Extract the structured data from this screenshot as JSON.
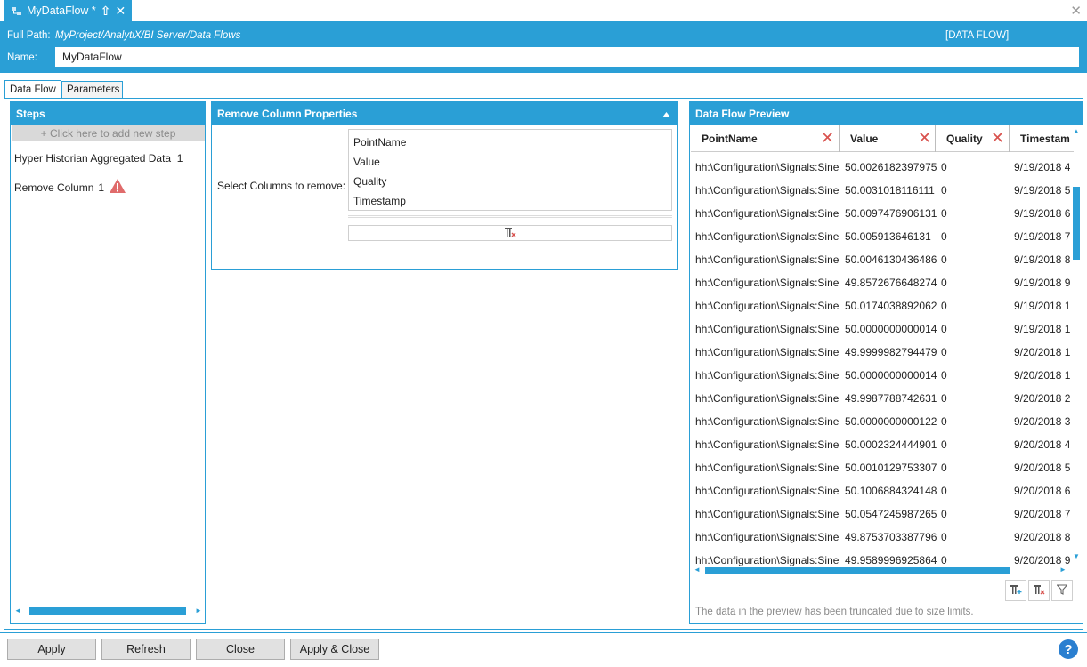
{
  "tab": {
    "title": "MyDataFlow *",
    "close_glyph": "✕",
    "pin_glyph": "⇧"
  },
  "window": {
    "close_glyph": "✕"
  },
  "header": {
    "full_path_label": "Full Path:",
    "full_path_value": "MyProject/AnalytiX/BI Server/Data Flows",
    "type_badge": "[DATA FLOW]",
    "name_label": "Name:",
    "name_value": "MyDataFlow"
  },
  "subtabs": {
    "data_flow": "Data Flow",
    "parameters": "Parameters"
  },
  "steps": {
    "title": "Steps",
    "add_step": "+ Click here to add new step",
    "items": [
      {
        "label": "Hyper Historian Aggregated Data",
        "count": "1"
      },
      {
        "label": "Remove Column",
        "count": "1"
      }
    ]
  },
  "props": {
    "title": "Remove Column Properties",
    "select_label": "Select Columns to remove:",
    "columns": [
      "PointName",
      "Value",
      "Quality",
      "Timestamp"
    ]
  },
  "preview": {
    "title": "Data Flow Preview",
    "headers": [
      "PointName",
      "Value",
      "Quality",
      "Timestam"
    ],
    "rows": [
      [
        "hh:\\Configuration\\Signals:Sine",
        "50.0026182397975",
        "0",
        "9/19/2018 4"
      ],
      [
        "hh:\\Configuration\\Signals:Sine",
        "50.0031018116111",
        "0",
        "9/19/2018 5"
      ],
      [
        "hh:\\Configuration\\Signals:Sine",
        "50.0097476906131",
        "0",
        "9/19/2018 6"
      ],
      [
        "hh:\\Configuration\\Signals:Sine",
        "50.005913646131",
        "0",
        "9/19/2018 7"
      ],
      [
        "hh:\\Configuration\\Signals:Sine",
        "50.0046130436486",
        "0",
        "9/19/2018 8"
      ],
      [
        "hh:\\Configuration\\Signals:Sine",
        "49.8572676648274",
        "0",
        "9/19/2018 9"
      ],
      [
        "hh:\\Configuration\\Signals:Sine",
        "50.0174038892062",
        "0",
        "9/19/2018 1"
      ],
      [
        "hh:\\Configuration\\Signals:Sine",
        "50.0000000000014",
        "0",
        "9/19/2018 1"
      ],
      [
        "hh:\\Configuration\\Signals:Sine",
        "49.9999982794479",
        "0",
        "9/20/2018 1"
      ],
      [
        "hh:\\Configuration\\Signals:Sine",
        "50.0000000000014",
        "0",
        "9/20/2018 1"
      ],
      [
        "hh:\\Configuration\\Signals:Sine",
        "49.9987788742631",
        "0",
        "9/20/2018 2"
      ],
      [
        "hh:\\Configuration\\Signals:Sine",
        "50.0000000000122",
        "0",
        "9/20/2018 3"
      ],
      [
        "hh:\\Configuration\\Signals:Sine",
        "50.0002324444901",
        "0",
        "9/20/2018 4"
      ],
      [
        "hh:\\Configuration\\Signals:Sine",
        "50.0010129753307",
        "0",
        "9/20/2018 5"
      ],
      [
        "hh:\\Configuration\\Signals:Sine",
        "50.1006884324148",
        "0",
        "9/20/2018 6"
      ],
      [
        "hh:\\Configuration\\Signals:Sine",
        "50.0547245987265",
        "0",
        "9/20/2018 7"
      ],
      [
        "hh:\\Configuration\\Signals:Sine",
        "49.8753703387796",
        "0",
        "9/20/2018 8"
      ],
      [
        "hh:\\Configuration\\Signals:Sine",
        "49.9589996925864",
        "0",
        "9/20/2018 9"
      ]
    ],
    "truncated_note": "The data in the preview has been truncated due to size limits."
  },
  "buttons": {
    "apply": "Apply",
    "refresh": "Refresh",
    "close": "Close",
    "apply_close": "Apply & Close"
  },
  "help_glyph": "?",
  "colors": {
    "accent": "#2a9fd6",
    "warning": "#d9534f"
  },
  "icons": [
    "dataflow-icon",
    "pin-icon",
    "close-icon",
    "warning-icon",
    "remove-column-icon",
    "add-column-icon",
    "filter-icon",
    "help-icon"
  ]
}
